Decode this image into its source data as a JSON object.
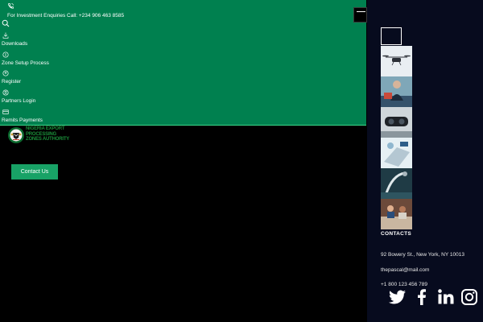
{
  "header": {
    "enquiry_text": "For Investment Enquiries Call: +234 906 463 8585"
  },
  "nav": {
    "items": [
      {
        "label": "Downloads",
        "icon": "download-icon"
      },
      {
        "label": "Zone Setup Process",
        "icon": "settings-icon"
      },
      {
        "label": "Register",
        "icon": "user-icon"
      },
      {
        "label": "Partners Login",
        "icon": "user-circle-icon"
      },
      {
        "label": "Remits Payments",
        "icon": "card-icon"
      }
    ]
  },
  "logo": {
    "line1": "NIGERIA EXPORT",
    "line2": "PROCESSING",
    "line3": "ZONES AUTHORITY"
  },
  "cta": {
    "contact_label": "Contact Us"
  },
  "side": {
    "contacts_title": "CONTACTS",
    "address": "92 Bowery St., New York, NY 10013",
    "email": "thepascal@mail.com",
    "phone": "+1 800 123 456 789",
    "socials": [
      "twitter-icon",
      "facebook-icon",
      "linkedin-icon",
      "instagram-icon"
    ]
  },
  "colors": {
    "green_panel": "#00804f",
    "button_green": "#18a266",
    "side_panel": "#070b1e"
  }
}
